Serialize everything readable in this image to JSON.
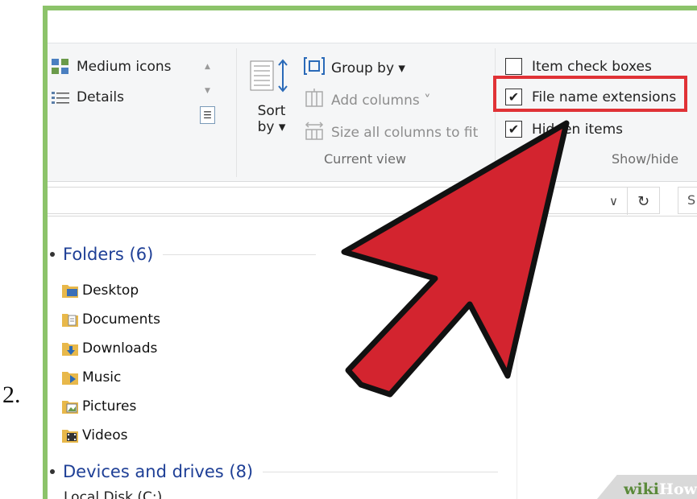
{
  "step_number": "2.",
  "ribbon": {
    "layout": {
      "medium_icons": "Medium icons",
      "details": "Details"
    },
    "current_view": {
      "sort_label_line1": "Sort",
      "sort_label_line2": "by ▾",
      "group_by": "Group by ▾",
      "add_columns": "Add columns ˅",
      "size_all_columns": "Size all columns to fit",
      "group_label": "Current view"
    },
    "show_hide": {
      "item_check_boxes": {
        "label": "Item check boxes",
        "checked": false
      },
      "file_name_extensions": {
        "label": "File name extensions",
        "checked": true
      },
      "hidden_items": {
        "label": "Hidden items",
        "checked": true
      },
      "group_label": "Show/hide",
      "check_glyph": "✔"
    }
  },
  "address_bar": {
    "dropdown_glyph": "∨",
    "refresh_glyph": "↻",
    "search_partial": "S"
  },
  "content": {
    "folders_heading": "Folders (6)",
    "folders": [
      {
        "name": "Desktop",
        "icon": "desktop-folder-icon"
      },
      {
        "name": "Documents",
        "icon": "documents-folder-icon"
      },
      {
        "name": "Downloads",
        "icon": "downloads-folder-icon"
      },
      {
        "name": "Music",
        "icon": "music-folder-icon"
      },
      {
        "name": "Pictures",
        "icon": "pictures-folder-icon"
      },
      {
        "name": "Videos",
        "icon": "videos-folder-icon"
      }
    ],
    "devices_heading": "Devices and drives (8)",
    "drive_partial": "Local Disk (C:)"
  },
  "watermark": {
    "part1": "wiki",
    "part2": "How"
  },
  "colors": {
    "arrow_fill": "#d3242f",
    "highlight_border": "#e03236",
    "heading_blue": "#1e3f96",
    "frame_green": "#8cc36a"
  }
}
